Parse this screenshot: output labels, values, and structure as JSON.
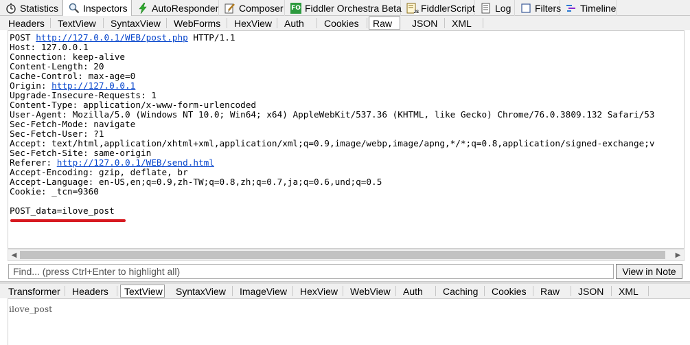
{
  "top_tabs": [
    {
      "label": "Statistics",
      "icon": "stopwatch-icon"
    },
    {
      "label": "Inspectors",
      "icon": "magnifier-icon",
      "active": true
    },
    {
      "label": "AutoResponder",
      "icon": "lightning-icon"
    },
    {
      "label": "Composer",
      "icon": "pencil-icon"
    },
    {
      "label": "Fiddler Orchestra Beta",
      "icon": "fo-icon",
      "icon_text": "FO"
    },
    {
      "label": "FiddlerScript",
      "icon": "script-icon",
      "icon_text": "JS"
    },
    {
      "label": "Log",
      "icon": "log-icon"
    },
    {
      "label": "Filters",
      "icon": "checkbox-icon"
    },
    {
      "label": "Timeline",
      "icon": "timeline-icon"
    }
  ],
  "request_tabs": [
    {
      "label": "Headers"
    },
    {
      "label": "TextView"
    },
    {
      "label": "SyntaxView"
    },
    {
      "label": "WebForms"
    },
    {
      "label": "HexView"
    },
    {
      "label": "Auth"
    },
    {
      "label": "Cookies"
    },
    {
      "label": "Raw",
      "active": true
    },
    {
      "label": "JSON"
    },
    {
      "label": "XML"
    }
  ],
  "raw_request": {
    "lines": [
      {
        "segments": [
          {
            "text": "POST "
          },
          {
            "text": "http://127.0.0.1/WEB/post.php",
            "link": true
          },
          {
            "text": " HTTP/1.1"
          }
        ]
      },
      {
        "segments": [
          {
            "text": "Host: 127.0.0.1"
          }
        ]
      },
      {
        "segments": [
          {
            "text": "Connection: keep-alive"
          }
        ]
      },
      {
        "segments": [
          {
            "text": "Content-Length: 20"
          }
        ]
      },
      {
        "segments": [
          {
            "text": "Cache-Control: max-age=0"
          }
        ]
      },
      {
        "segments": [
          {
            "text": "Origin: "
          },
          {
            "text": "http://127.0.0.1",
            "link": true
          }
        ]
      },
      {
        "segments": [
          {
            "text": "Upgrade-Insecure-Requests: 1"
          }
        ]
      },
      {
        "segments": [
          {
            "text": "Content-Type: application/x-www-form-urlencoded"
          }
        ]
      },
      {
        "segments": [
          {
            "text": "User-Agent: Mozilla/5.0 (Windows NT 10.0; Win64; x64) AppleWebKit/537.36 (KHTML, like Gecko) Chrome/76.0.3809.132 Safari/53"
          }
        ]
      },
      {
        "segments": [
          {
            "text": "Sec-Fetch-Mode: navigate"
          }
        ]
      },
      {
        "segments": [
          {
            "text": "Sec-Fetch-User: ?1"
          }
        ]
      },
      {
        "segments": [
          {
            "text": "Accept: text/html,application/xhtml+xml,application/xml;q=0.9,image/webp,image/apng,*/*;q=0.8,application/signed-exchange;v"
          }
        ]
      },
      {
        "segments": [
          {
            "text": "Sec-Fetch-Site: same-origin"
          }
        ]
      },
      {
        "segments": [
          {
            "text": "Referer: "
          },
          {
            "text": "http://127.0.0.1/WEB/send.html",
            "link": true
          }
        ]
      },
      {
        "segments": [
          {
            "text": "Accept-Encoding: gzip, deflate, br"
          }
        ]
      },
      {
        "segments": [
          {
            "text": "Accept-Language: en-US,en;q=0.9,zh-TW;q=0.8,zh;q=0.7,ja;q=0.6,und;q=0.5"
          }
        ]
      },
      {
        "segments": [
          {
            "text": "Cookie: _tcn=9360"
          }
        ]
      },
      {
        "segments": [
          {
            "text": ""
          }
        ]
      },
      {
        "segments": [
          {
            "text": "POST_data=ilove_post"
          }
        ]
      }
    ],
    "highlight_color": "#d71920",
    "link_color": "#0645cc"
  },
  "find": {
    "placeholder": "Find... (press Ctrl+Enter to highlight all)",
    "note_button": "View in Note"
  },
  "response_tabs": [
    {
      "label": "Transformer"
    },
    {
      "label": "Headers"
    },
    {
      "label": "TextView",
      "active": true
    },
    {
      "label": "SyntaxView"
    },
    {
      "label": "ImageView"
    },
    {
      "label": "HexView"
    },
    {
      "label": "WebView"
    },
    {
      "label": "Auth"
    },
    {
      "label": "Caching"
    },
    {
      "label": "Cookies"
    },
    {
      "label": "Raw"
    },
    {
      "label": "JSON"
    },
    {
      "label": "XML"
    }
  ],
  "response_body": {
    "text": "ilove_post"
  }
}
